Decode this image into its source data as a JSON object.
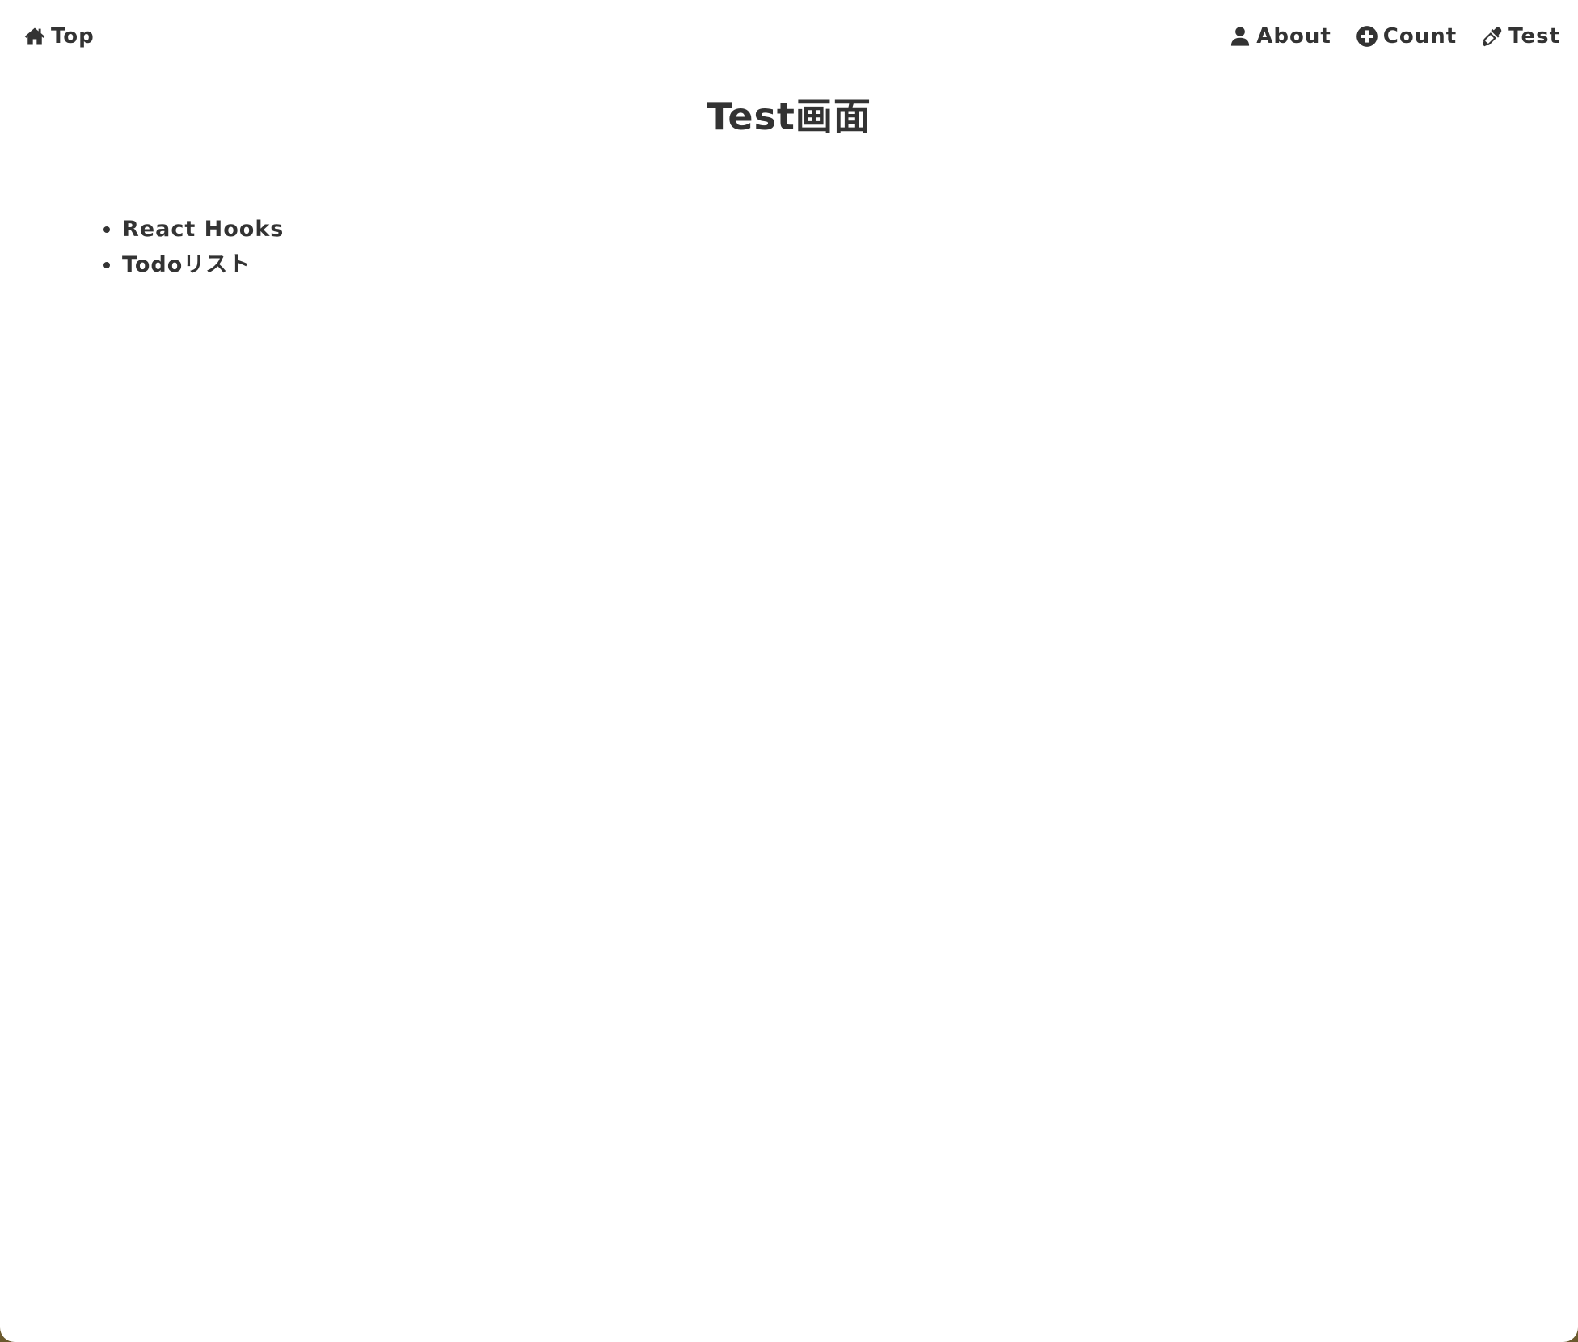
{
  "nav": {
    "home": {
      "label": "Top",
      "icon": "home-icon"
    },
    "right": [
      {
        "label": "About",
        "icon": "user-icon"
      },
      {
        "label": "Count",
        "icon": "plus-circle-icon"
      },
      {
        "label": "Test",
        "icon": "eyedropper-icon"
      }
    ]
  },
  "page": {
    "title": "Test画面",
    "items": [
      "React Hooks",
      "Todoリスト"
    ]
  },
  "colors": {
    "text": "#333333",
    "background": "#ffffff"
  }
}
